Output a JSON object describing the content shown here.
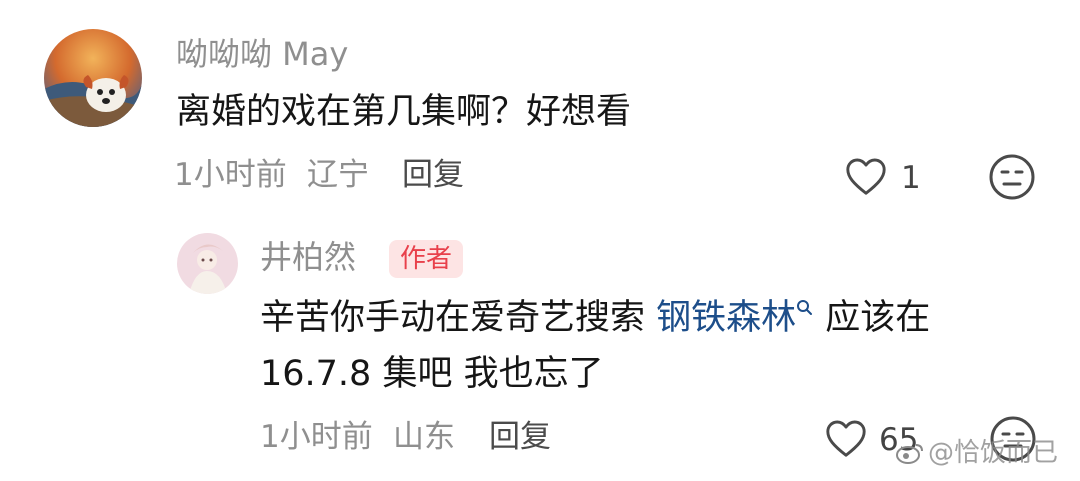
{
  "comments": [
    {
      "username": "呦呦呦 May",
      "content": "离婚的戏在第几集啊？好想看",
      "time": "1小时前",
      "location": "辽宁",
      "reply_label": "回复",
      "like_count": "1"
    }
  ],
  "reply": {
    "username": "井柏然",
    "author_tag": "作者",
    "content_line1_pre": "辛苦你手动在爱奇艺搜索 ",
    "search_link": "钢铁森林",
    "content_line1_post": " 应该在",
    "content_line2": "16.7.8 集吧 我也忘了",
    "time": "1小时前",
    "location": "山东",
    "reply_label": "回复",
    "like_count": "65"
  },
  "watermark": "@恰饭而已",
  "colors": {
    "link": "#1d4e8a",
    "author_tag_bg": "#fde4e4",
    "author_tag_text": "#e8404b"
  }
}
